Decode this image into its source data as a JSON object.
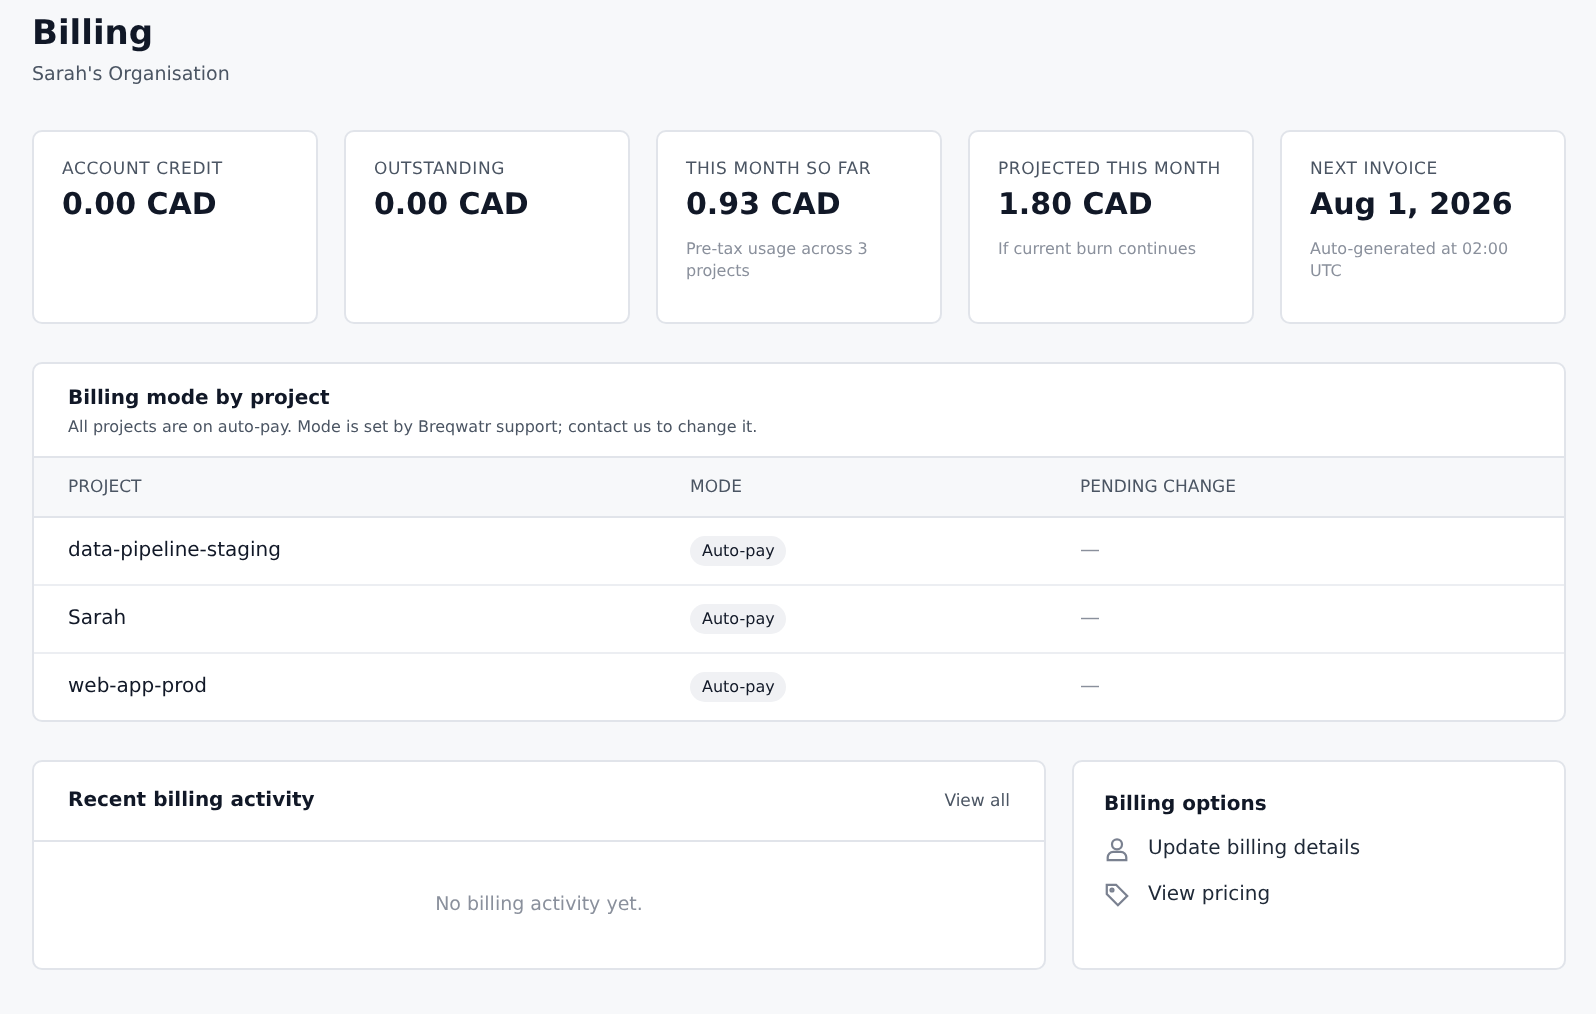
{
  "page": {
    "title": "Billing",
    "subtitle": "Sarah's Organisation"
  },
  "stats": [
    {
      "label": "ACCOUNT CREDIT",
      "value": "0.00 CAD"
    },
    {
      "label": "OUTSTANDING",
      "value": "0.00 CAD"
    },
    {
      "label": "THIS MONTH SO FAR",
      "value": "0.93 CAD",
      "note": "Pre-tax usage across 3 projects"
    },
    {
      "label": "PROJECTED THIS MONTH",
      "value": "1.80 CAD",
      "note": "If current burn continues"
    },
    {
      "label": "NEXT INVOICE",
      "value": "Aug 1, 2026",
      "note": "Auto-generated at 02:00 UTC"
    }
  ],
  "billing_mode": {
    "title": "Billing mode by project",
    "description": "All projects are on auto-pay. Mode is set by Breqwatr support; contact us to change it.",
    "columns": [
      "PROJECT",
      "MODE",
      "PENDING CHANGE"
    ],
    "rows": [
      {
        "project": "data-pipeline-staging",
        "mode": "Auto-pay",
        "pending": "—"
      },
      {
        "project": "Sarah",
        "mode": "Auto-pay",
        "pending": "—"
      },
      {
        "project": "web-app-prod",
        "mode": "Auto-pay",
        "pending": "—"
      }
    ]
  },
  "activity": {
    "title": "Recent billing activity",
    "link": "View all",
    "empty": "No billing activity yet."
  },
  "options": {
    "title": "Billing options",
    "items": [
      {
        "kind": "person",
        "label": "Update billing details"
      },
      {
        "kind": "tag",
        "label": "View pricing"
      }
    ]
  }
}
